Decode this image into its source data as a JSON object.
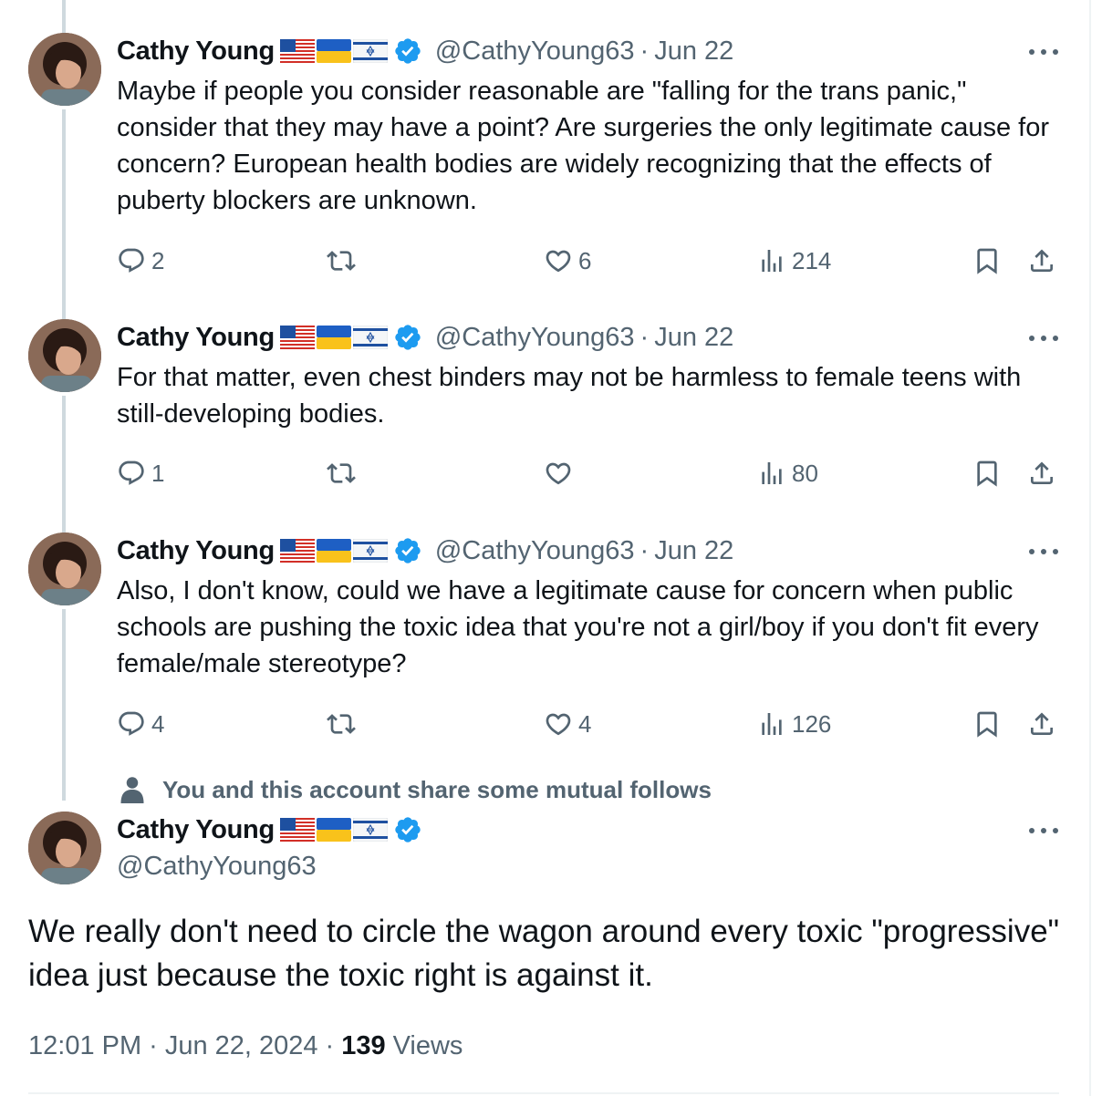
{
  "author": {
    "name": "Cathy Young",
    "handle": "@CathyYoung63",
    "flags": [
      "us-flag",
      "ukraine-flag",
      "israel-flag"
    ],
    "verified_color": "#1d9bf0"
  },
  "thread": [
    {
      "date": "Jun 22",
      "separator": "·",
      "text": "Maybe if people you consider reasonable are \"falling for the trans panic,\" consider that they may have a point? Are surgeries the only legitimate cause for concern? European health bodies are widely recognizing that the effects of puberty blockers are unknown.",
      "replies": "2",
      "reposts": "",
      "likes": "6",
      "views": "214"
    },
    {
      "date": "Jun 22",
      "separator": "·",
      "text": "For that matter, even chest binders may not be harmless to female teens with still-developing bodies.",
      "replies": "1",
      "reposts": "",
      "likes": "",
      "views": "80"
    },
    {
      "date": "Jun 22",
      "separator": "·",
      "text": "Also, I don't know, could we have a legitimate cause for concern when public schools are pushing the toxic idea that you're not a girl/boy if you don't fit every female/male stereotype?",
      "replies": "4",
      "reposts": "",
      "likes": "4",
      "views": "126"
    }
  ],
  "mutual_follows": "You and this account share some mutual follows",
  "main_tweet": {
    "text": "We really don't need to circle the wagon around every toxic \"progressive\" idea just because the toxic right is against it.",
    "time": "12:01 PM",
    "sep1": "·",
    "date": "Jun 22, 2024",
    "sep2": "·",
    "views_count": "139",
    "views_label": "Views"
  },
  "colors": {
    "text": "#0f1419",
    "secondary": "#536471",
    "thread_line": "#cfd9de",
    "border": "#eff3f4",
    "verified": "#1d9bf0"
  }
}
